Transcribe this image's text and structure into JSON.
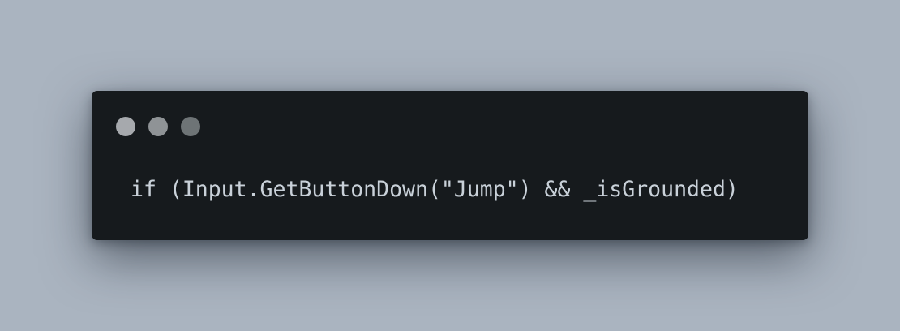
{
  "colors": {
    "background": "#aab4c0",
    "window_background": "#161a1d",
    "code_text": "#c9d1d9",
    "control_dots": [
      "#a6a9ad",
      "#8f9396",
      "#6e7476"
    ]
  },
  "window": {
    "controls": [
      "window-control-dot",
      "window-control-dot",
      "window-control-dot"
    ]
  },
  "code": {
    "line": "if (Input.GetButtonDown(\"Jump\") && _isGrounded)"
  }
}
